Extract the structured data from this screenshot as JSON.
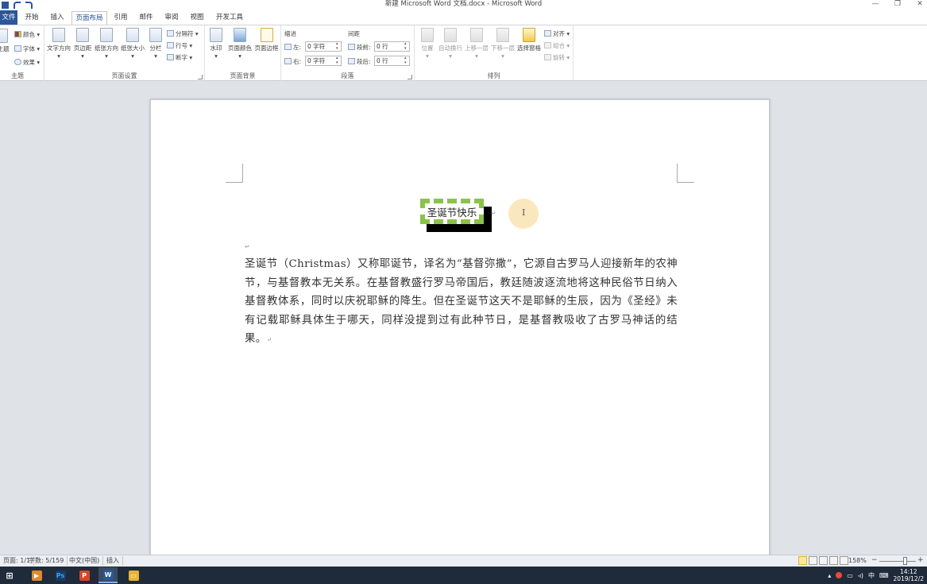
{
  "window": {
    "title": "新建 Microsoft Word 文档.docx  -  Microsoft Word",
    "controls": [
      "—",
      "❐",
      "✕"
    ]
  },
  "tabs": [
    {
      "label": "文件",
      "state": "file"
    },
    {
      "label": "开始"
    },
    {
      "label": "插入"
    },
    {
      "label": "页面布局",
      "state": "active"
    },
    {
      "label": "引用"
    },
    {
      "label": "邮件"
    },
    {
      "label": "审阅"
    },
    {
      "label": "视图"
    },
    {
      "label": "开发工具"
    }
  ],
  "ribbon": {
    "theme": {
      "label": "主题",
      "items": {
        "theme_btn": "主题",
        "colors": "颜色 ▾",
        "fonts": "字体 ▾",
        "effects": "效果 ▾"
      }
    },
    "page_setup": {
      "label": "页面设置",
      "buttons": [
        "文字方向",
        "页边距",
        "纸张方向",
        "纸张大小",
        "分栏"
      ],
      "small": [
        "分隔符 ▾",
        "行号 ▾",
        "断字 ▾"
      ]
    },
    "page_background": {
      "label": "页面背景",
      "buttons": [
        "水印",
        "页面颜色",
        "页面边框"
      ]
    },
    "paragraph": {
      "label": "段落",
      "indent_title": "缩进",
      "spacing_title": "间距",
      "indent_left_label": "左:",
      "indent_left_value": "0 字符",
      "indent_right_label": "右:",
      "indent_right_value": "0 字符",
      "spacing_before_label": "段前:",
      "spacing_before_value": "0 行",
      "spacing_after_label": "段后:",
      "spacing_after_value": "0 行"
    },
    "arrange": {
      "label": "排列",
      "buttons": [
        "位置",
        "自动换行",
        "上移一层",
        "下移一层",
        "选择窗格"
      ],
      "small": [
        "对齐 ▾",
        "组合 ▾",
        "旋转 ▾"
      ]
    }
  },
  "document": {
    "heading": "圣诞节快乐",
    "body": "圣诞节（Christmas）又称耶诞节，译名为“基督弥撒”，它源自古罗马人迎接新年的农神节，与基督教本无关系。在基督教盛行罗马帝国后，教廷随波逐流地将这种民俗节日纳入基督教体系，同时以庆祝耶稣的降生。但在圣诞节这天不是耶稣的生辰，因为《圣经》未有记载耶稣具体生于哪天，同样没提到过有此种节日，是基督教吸收了古罗马神话的结果。",
    "para_mark": "↵",
    "colors": {
      "border": "#8bc34a",
      "shadow": "#000000",
      "halo": "#fbe7bd"
    }
  },
  "statusbar": {
    "page": "页面: 1/1",
    "words": "字数: 5/159",
    "language": "中文(中国)",
    "mode": "插入",
    "zoom": "158%",
    "zoom_minus": "−",
    "zoom_plus": "+"
  },
  "taskbar": {
    "apps": [
      {
        "icon": "windows-start-icon",
        "glyph": "⊞",
        "color": "#ffffff"
      },
      {
        "icon": "media-player-icon",
        "glyph": "▶",
        "color": "#e08a2c"
      },
      {
        "icon": "photoshop-icon",
        "glyph": "Ps",
        "color": "#1c3a63"
      },
      {
        "icon": "powerpoint-icon",
        "glyph": "P",
        "color": "#d24726"
      },
      {
        "icon": "word-icon",
        "glyph": "W",
        "color": "#2b579a"
      },
      {
        "icon": "file-explorer-icon",
        "glyph": "▭",
        "color": "#e8b23a"
      }
    ],
    "tray_ime": "中",
    "time": "14:12",
    "date": "2019/12/2"
  }
}
